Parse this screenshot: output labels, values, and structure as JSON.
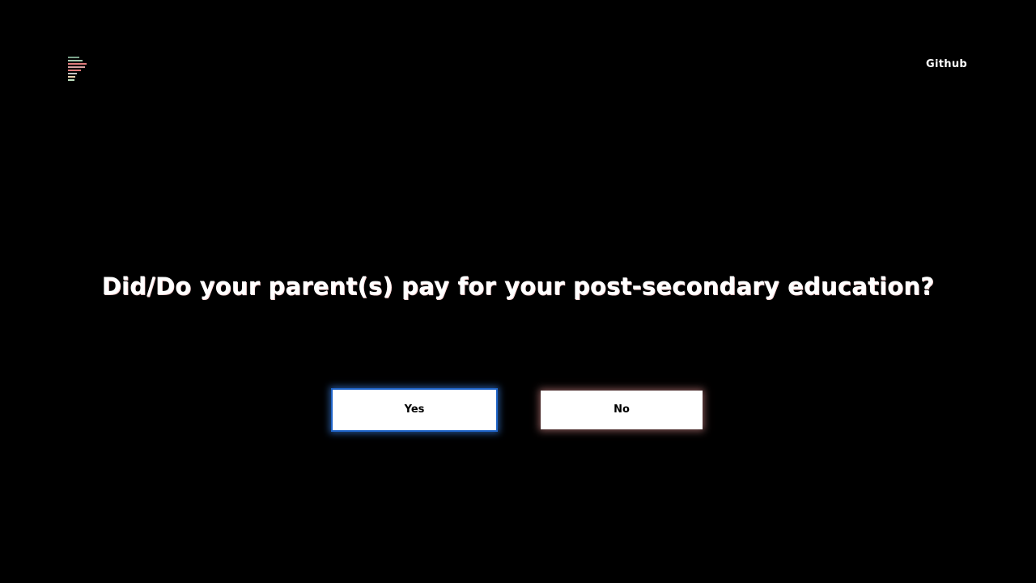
{
  "header": {
    "logo_icon": "stacked-bars-logo-icon",
    "logo_colors": [
      "#7aa38a",
      "#a8c8b0",
      "#e07a7a",
      "#d8a0a0",
      "#c0c0c0",
      "#e8d0b0",
      "#c0e0c0"
    ],
    "nav_link_label": "Github"
  },
  "question": {
    "text": "Did/Do your parent(s) pay for your post-secondary education?"
  },
  "answers": {
    "yes_label": "Yes",
    "no_label": "No"
  },
  "colors": {
    "background": "#000000",
    "text": "#ffffff",
    "yes_focus_outline": "#1f64c8",
    "no_glow": "#eb9696"
  }
}
